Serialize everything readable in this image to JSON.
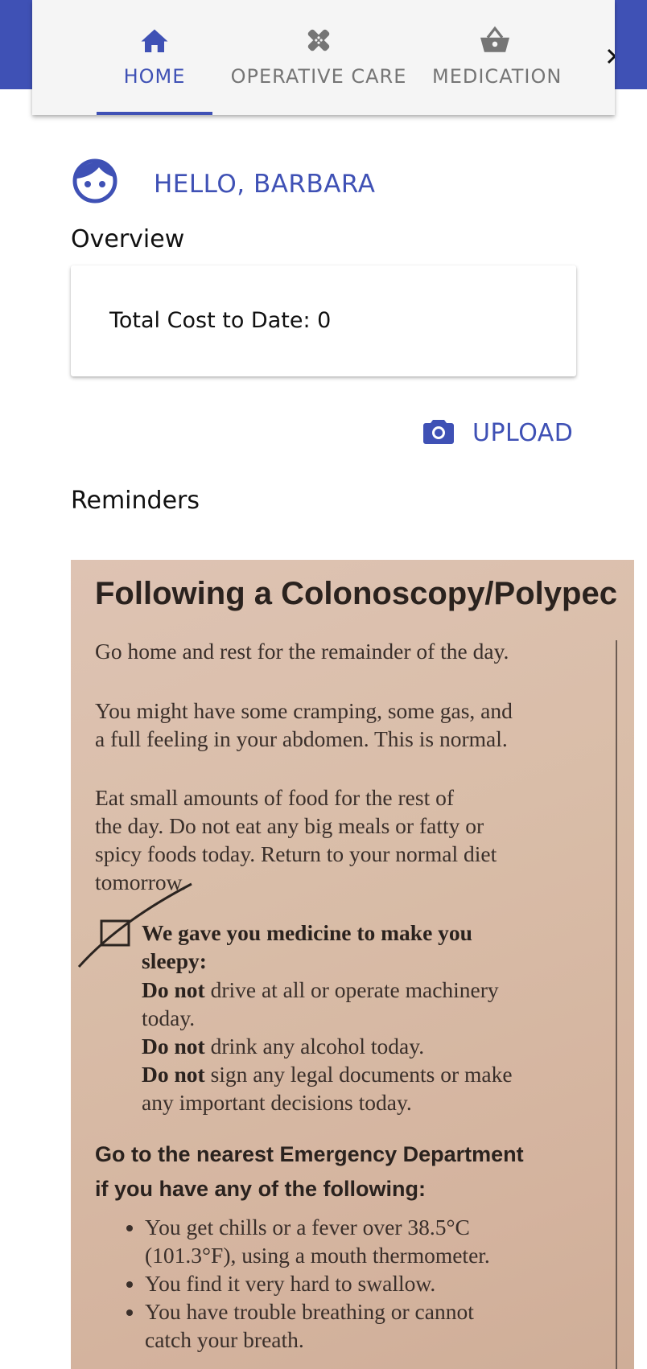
{
  "tabs": [
    {
      "label": "HOME",
      "icon": "home-icon",
      "active": true
    },
    {
      "label": "OPERATIVE CARE",
      "icon": "bandage-icon",
      "active": false
    },
    {
      "label": "MEDICATION",
      "icon": "basket-icon",
      "active": false
    }
  ],
  "nav": {
    "next_icon": "chevron-right-icon"
  },
  "greeting": {
    "icon": "face-icon",
    "text": "HELLO, BARBARA"
  },
  "overview": {
    "title": "Overview",
    "total_cost": "Total Cost to Date: 0"
  },
  "upload": {
    "icon": "camera-icon",
    "label": "UPLOAD"
  },
  "reminders": {
    "title": "Reminders",
    "photo": {
      "title": "Following a Colonoscopy/Polypec",
      "p1": "Go home and rest for the remainder of the day.",
      "p2_l1": "You might have some cramping, some gas, and",
      "p2_l2": "a full feeling in your abdomen. This is normal.",
      "p3_l1": "Eat small amounts of food for the rest of",
      "p3_l2": "the day. Do not eat any big meals or fatty or",
      "p3_l3": "spicy foods today. Return to your normal diet",
      "p3_l4": "tomorrow.",
      "p4_l1": "We gave you medicine to make you",
      "p4_l2": "sleepy:",
      "p4_do_not": "Do not",
      "p4_l3_rest": "drive at all or operate machinery",
      "p4_l4": "today.",
      "p4_l5_rest": "drink any alcohol today.",
      "p4_l6_rest": "sign any legal documents or make",
      "p4_l7": "any important decisions today.",
      "h1": "Go to the nearest Emergency Department",
      "h2": "if you have any of the following:",
      "bullets": [
        "You get chills or a fever over 38.5°C",
        "(101.3°F), using a mouth thermometer.",
        "You find it very hard to swallow.",
        "You have trouble breathing or cannot",
        "catch your breath."
      ]
    }
  },
  "colors": {
    "primary": "#3f51b5",
    "inactive": "#757575"
  }
}
